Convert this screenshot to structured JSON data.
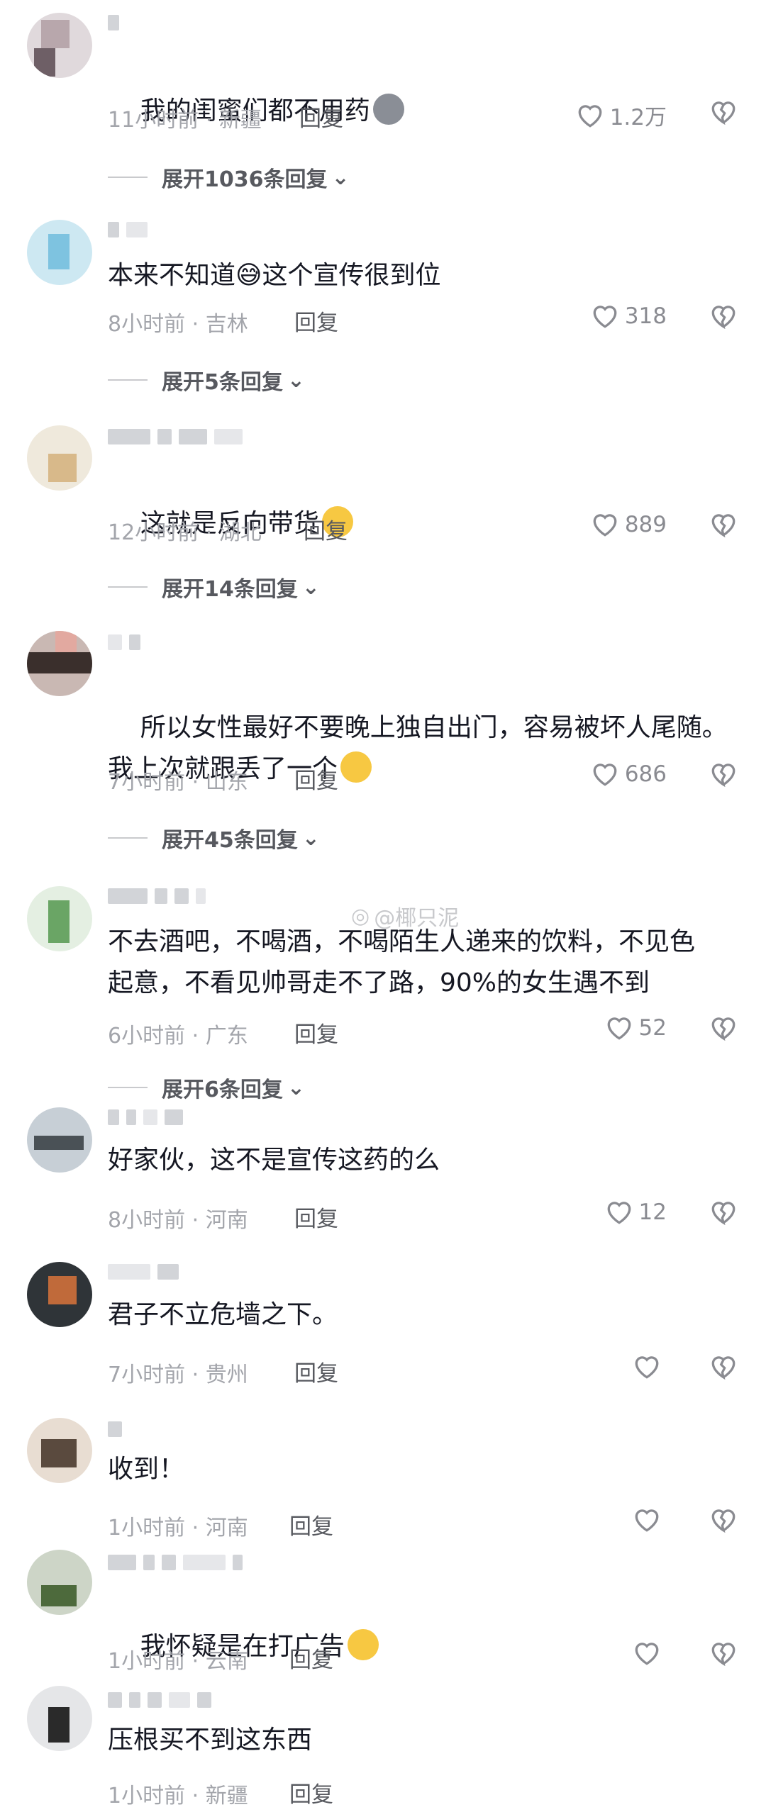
{
  "comments": [
    {
      "text": "我的闺蜜们都不用药",
      "time": "11小时前 · 新疆",
      "reply": "回复",
      "likes": "1.2万",
      "expand": "展开1036条回复",
      "emoji": "dog-face"
    },
    {
      "text": "本来不知道😅这个宣传很到位",
      "time": "8小时前 · 吉林",
      "reply": "回复",
      "likes": "318",
      "expand": "展开5条回复"
    },
    {
      "text": "这就是反向带货",
      "time": "12小时前 · 湖北",
      "reply": "回复",
      "likes": "889",
      "expand": "展开14条回复",
      "emoji": "winking-face-with-tongue"
    },
    {
      "text": "所以女性最好不要晚上独自出门，容易被坏人尾随。\n我上次就跟丢了一个",
      "time": "7小时前 · 山东",
      "reply": "回复",
      "likes": "686",
      "expand": "展开45条回复",
      "emoji": "pleading-face"
    },
    {
      "text": "不去酒吧，不喝酒，不喝陌生人递来的饮料，不见色\n起意，不看见帅哥走不了路，90%的女生遇不到",
      "time": "6小时前 · 广东",
      "reply": "回复",
      "likes": "52",
      "expand": "展开6条回复"
    },
    {
      "text": "好家伙，这不是宣传这药的么",
      "time": "8小时前 · 河南",
      "reply": "回复",
      "likes": "12"
    },
    {
      "text": "君子不立危墙之下。",
      "time": "7小时前 · 贵州",
      "reply": "回复",
      "likes": ""
    },
    {
      "text": "收到！",
      "time": "1小时前 · 河南",
      "reply": "回复",
      "likes": ""
    },
    {
      "text": "我怀疑是在打广告",
      "time": "1小时前 · 云南",
      "reply": "回复",
      "likes": "",
      "emoji": "grinning-face"
    },
    {
      "text": "压根买不到这东西",
      "time": "1小时前 · 新疆",
      "reply": "回复",
      "likes": ""
    }
  ],
  "watermark": "@椰只泥",
  "colors": {
    "meta": "#a3a5ab",
    "text": "#161823",
    "reply": "#57595f"
  }
}
